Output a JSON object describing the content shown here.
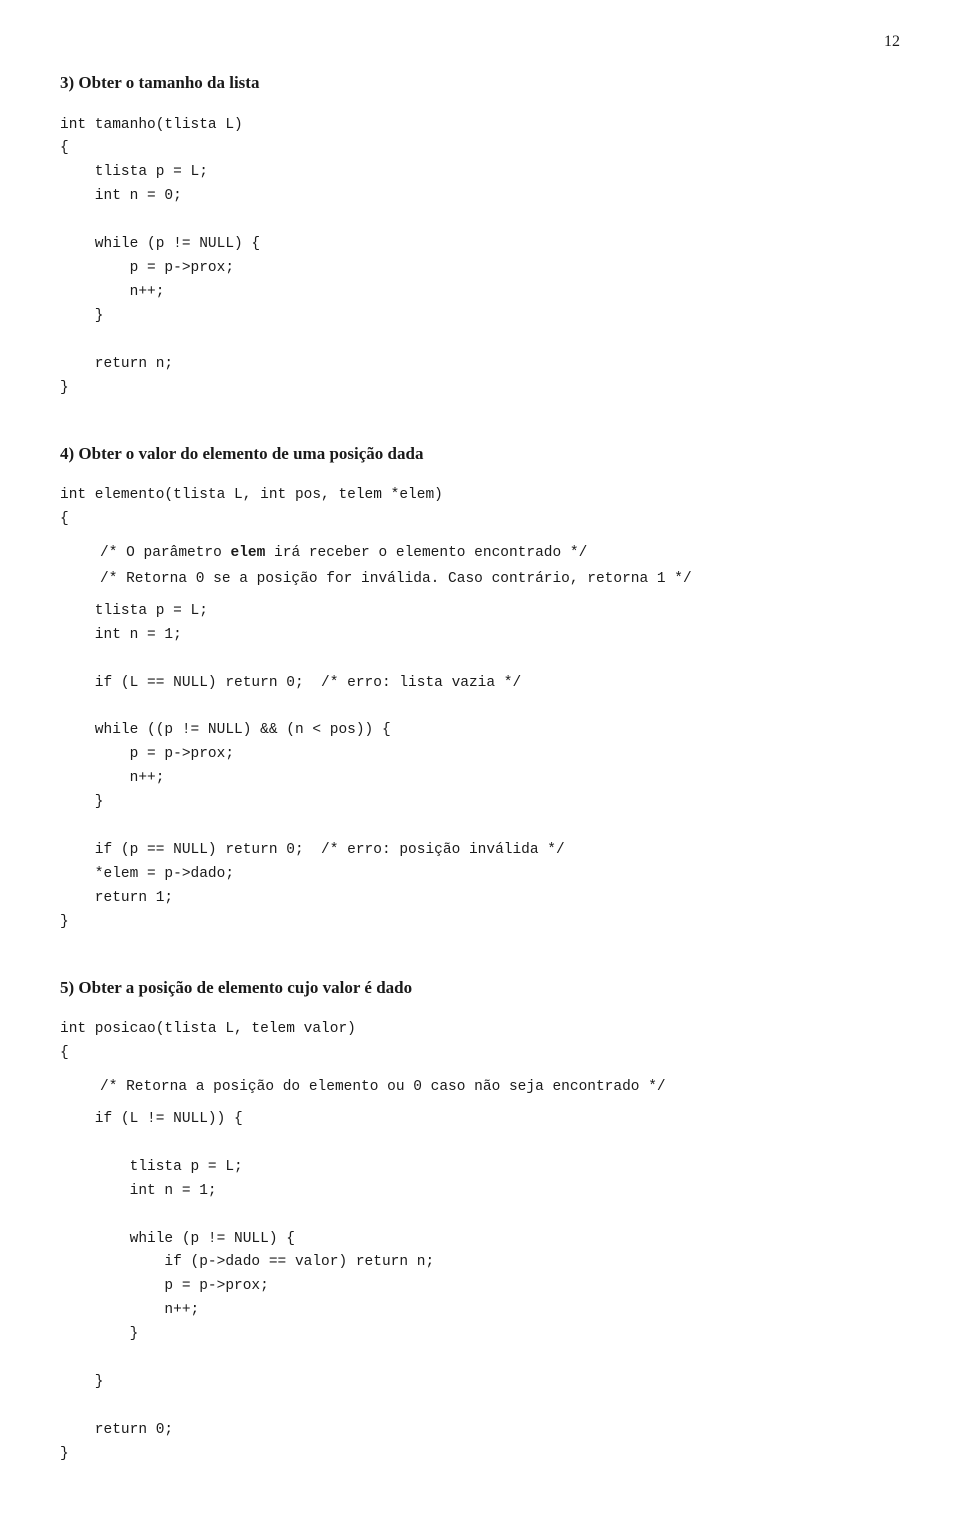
{
  "page": {
    "number": "12",
    "sections": [
      {
        "id": "section3",
        "number": "3)",
        "title": "Obter o tamanho da lista",
        "code": "int tamanho(tlista L)\n{\n    tlista p = L;\n    int n = 0;\n\n    while (p != NULL) {\n        p = p->prox;\n        n++;\n    }\n\n    return n;\n}",
        "comments": []
      },
      {
        "id": "section4",
        "number": "4)",
        "title": "Obter o valor do elemento de uma posição dada",
        "signature": "int elemento(tlista L, int pos, telem *elem)",
        "open_brace": "{",
        "comment1": "/* O parâmetro elem irá receber o elemento encontrado */",
        "comment1_bold": "elem",
        "comment2": "/* Retorna 0 se a posição for inválida. Caso contrário, retorna 1 */",
        "code_body": "    tlista p = L;\n    int n = 1;\n\n    if (L == NULL) return 0;  /* erro: lista vazia */\n\n    while ((p != NULL) && (n < pos)) {\n        p = p->prox;\n        n++;\n    }\n\n    if (p == NULL) return 0;  /* erro: posição inválida */\n    *elem = p->dado;\n    return 1;\n}",
        "comments": []
      },
      {
        "id": "section5",
        "number": "5)",
        "title": "Obter a posição de elemento cujo valor é dado",
        "signature": "int posicao(tlista L, telem valor)",
        "open_brace": "{",
        "comment1": "/* Retorna a posição do elemento ou 0 caso não seja encontrado */",
        "code_body": "    if (L != NULL)) {\n\n        tlista p = L;\n        int n = 1;\n\n        while (p != NULL) {\n            if (p->dado == valor) return n;\n            p = p->prox;\n            n++;\n        }\n\n    }\n\n    return 0;\n}",
        "comments": []
      }
    ]
  }
}
